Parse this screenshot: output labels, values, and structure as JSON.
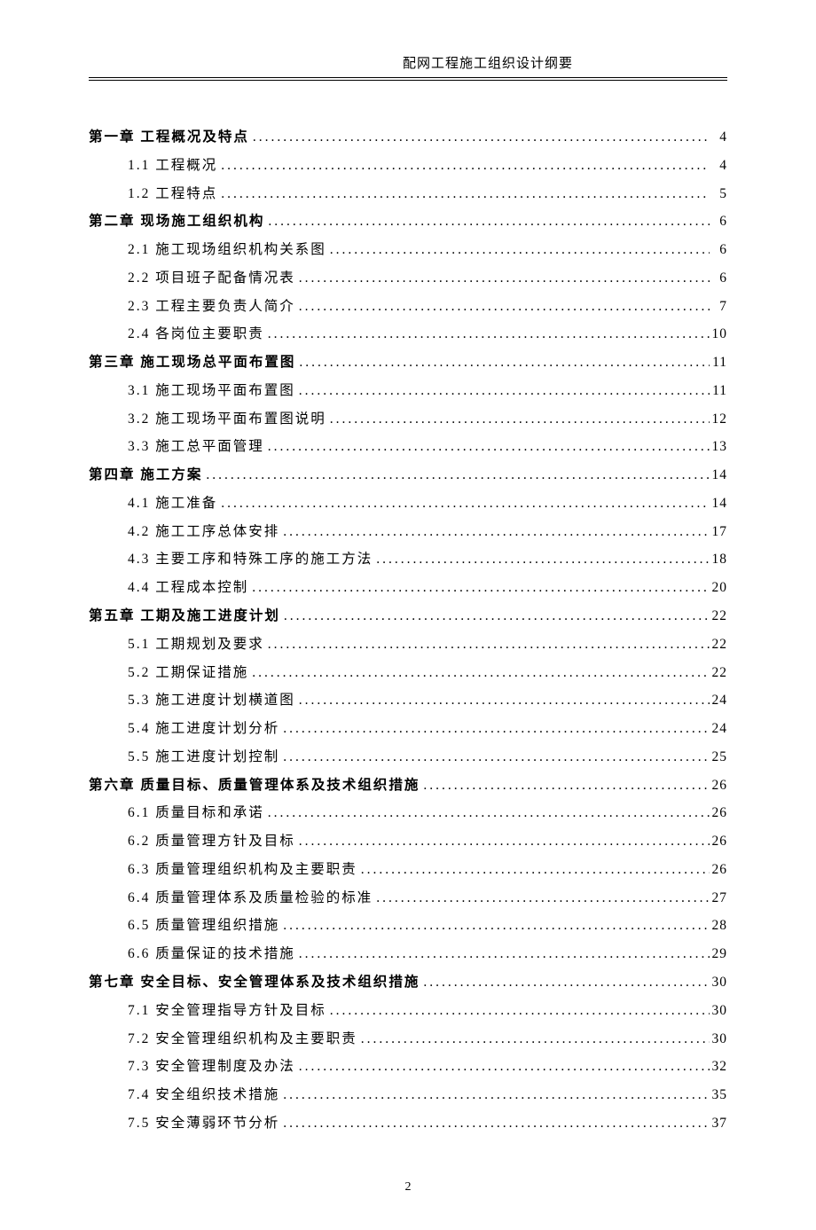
{
  "header": {
    "title": "配网工程施工组织设计纲要"
  },
  "footer": {
    "page_number": "2"
  },
  "toc": [
    {
      "type": "chapter",
      "label": "第一章 工程概况及特点",
      "page": "4"
    },
    {
      "type": "sub",
      "label": "1.1 工程概况",
      "page": "4"
    },
    {
      "type": "sub",
      "label": "1.2 工程特点",
      "page": "5"
    },
    {
      "type": "chapter",
      "label": "第二章 现场施工组织机构",
      "page": "6"
    },
    {
      "type": "sub",
      "label": "2.1 施工现场组织机构关系图",
      "page": "6"
    },
    {
      "type": "sub",
      "label": "2.2 项目班子配备情况表",
      "page": "6"
    },
    {
      "type": "sub",
      "label": "2.3 工程主要负责人简介",
      "page": "7"
    },
    {
      "type": "sub",
      "label": "2.4 各岗位主要职责",
      "page": "10"
    },
    {
      "type": "chapter",
      "label": "第三章 施工现场总平面布置图",
      "page": "11"
    },
    {
      "type": "sub",
      "label": "3.1 施工现场平面布置图",
      "page": "11"
    },
    {
      "type": "sub",
      "label": "3.2 施工现场平面布置图说明",
      "page": "12"
    },
    {
      "type": "sub",
      "label": "3.3 施工总平面管理",
      "page": "13"
    },
    {
      "type": "chapter",
      "label": "第四章 施工方案",
      "page": "14"
    },
    {
      "type": "sub",
      "label": "4.1 施工准备",
      "page": "14"
    },
    {
      "type": "sub",
      "label": "4.2 施工工序总体安排",
      "page": "17"
    },
    {
      "type": "sub",
      "label": "4.3 主要工序和特殊工序的施工方法",
      "page": "18"
    },
    {
      "type": "sub",
      "label": "4.4 工程成本控制",
      "page": "20"
    },
    {
      "type": "chapter",
      "label": "第五章 工期及施工进度计划",
      "page": "22"
    },
    {
      "type": "sub",
      "label": "5.1 工期规划及要求",
      "page": "22"
    },
    {
      "type": "sub",
      "label": "5.2 工期保证措施",
      "page": "22"
    },
    {
      "type": "sub",
      "label": "5.3 施工进度计划横道图",
      "page": "24"
    },
    {
      "type": "sub",
      "label": "5.4 施工进度计划分析",
      "page": "24"
    },
    {
      "type": "sub",
      "label": "5.5 施工进度计划控制",
      "page": "25"
    },
    {
      "type": "chapter",
      "label": "第六章 质量目标、质量管理体系及技术组织措施",
      "page": "26"
    },
    {
      "type": "sub",
      "label": "6.1 质量目标和承诺",
      "page": "26"
    },
    {
      "type": "sub",
      "label": "6.2 质量管理方针及目标",
      "page": "26"
    },
    {
      "type": "sub",
      "label": "6.3 质量管理组织机构及主要职责",
      "page": "26"
    },
    {
      "type": "sub",
      "label": "6.4 质量管理体系及质量检验的标准",
      "page": "27"
    },
    {
      "type": "sub",
      "label": "6.5 质量管理组织措施",
      "page": "28"
    },
    {
      "type": "sub",
      "label": "6.6 质量保证的技术措施",
      "page": "29"
    },
    {
      "type": "chapter",
      "label": "第七章 安全目标、安全管理体系及技术组织措施",
      "page": "30"
    },
    {
      "type": "sub",
      "label": "7.1 安全管理指导方针及目标",
      "page": "30"
    },
    {
      "type": "sub",
      "label": "7.2 安全管理组织机构及主要职责",
      "page": "30"
    },
    {
      "type": "sub",
      "label": "7.3 安全管理制度及办法",
      "page": "32"
    },
    {
      "type": "sub",
      "label": "7.4 安全组织技术措施",
      "page": "35"
    },
    {
      "type": "sub",
      "label": "7.5 安全薄弱环节分析",
      "page": "37"
    }
  ]
}
